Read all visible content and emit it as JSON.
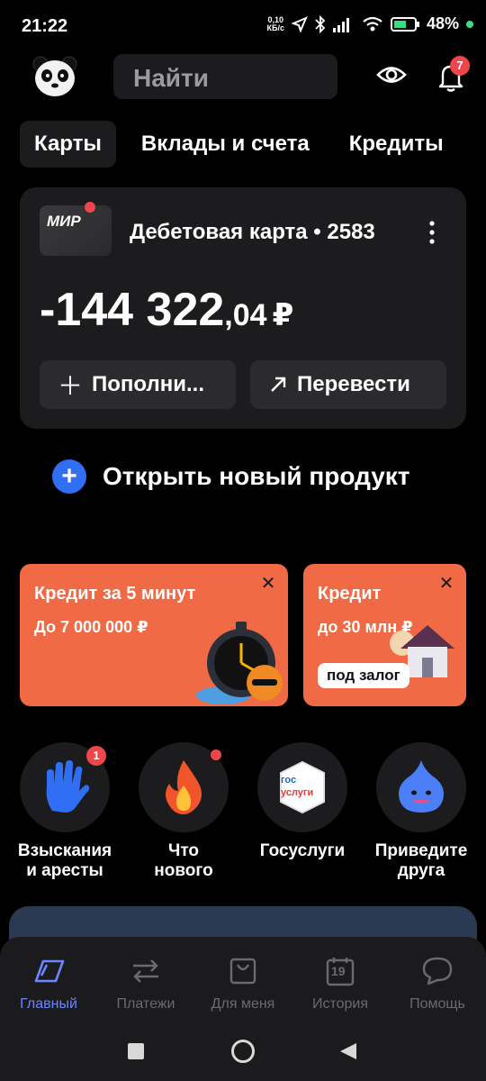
{
  "status_bar": {
    "time": "21:22",
    "speed_value": "0,10",
    "speed_unit": "КБ/с",
    "battery": "48"
  },
  "header": {
    "search_placeholder": "Найти",
    "notifications_count": "7"
  },
  "tabs": [
    "Карты",
    "Вклады и счета",
    "Кредиты"
  ],
  "card": {
    "brand": "МИР",
    "name": "Дебетовая карта • 2583",
    "balance_int": "-144 322",
    "balance_dec": ",04",
    "currency": "₽",
    "topup_label": "Пополни...",
    "transfer_label": "Перевести"
  },
  "open_product": "Открыть новый продукт",
  "promos": [
    {
      "title": "Кредит за 5 минут",
      "subtitle": "До 7 000 000 ₽"
    },
    {
      "title": "Кредит",
      "subtitle": "до 30 млн ₽",
      "tag": "под залог"
    }
  ],
  "quick_actions": [
    {
      "label_1": "Взыскания",
      "label_2": "и аресты",
      "badge": "1"
    },
    {
      "label_1": "Что",
      "label_2": "нового"
    },
    {
      "label_1": "Госуслуги",
      "label_2": "",
      "logo_top": "гос",
      "logo_bottom": "услуги"
    },
    {
      "label_1": "Приведите",
      "label_2": "друга"
    }
  ],
  "bottom_nav": [
    {
      "label": "Главный",
      "icon": "home-icon",
      "active": true
    },
    {
      "label": "Платежи",
      "icon": "transfer-arrows-icon"
    },
    {
      "label": "Для меня",
      "icon": "bag-icon"
    },
    {
      "label": "История",
      "icon": "calendar-icon",
      "calendar_day": "19"
    },
    {
      "label": "Помощь",
      "icon": "chat-bubble-icon"
    }
  ],
  "colors": {
    "accent": "#6b86ff",
    "promo": "#ef6a45",
    "badge": "#f0454a",
    "plus_button": "#2f6ef5"
  }
}
